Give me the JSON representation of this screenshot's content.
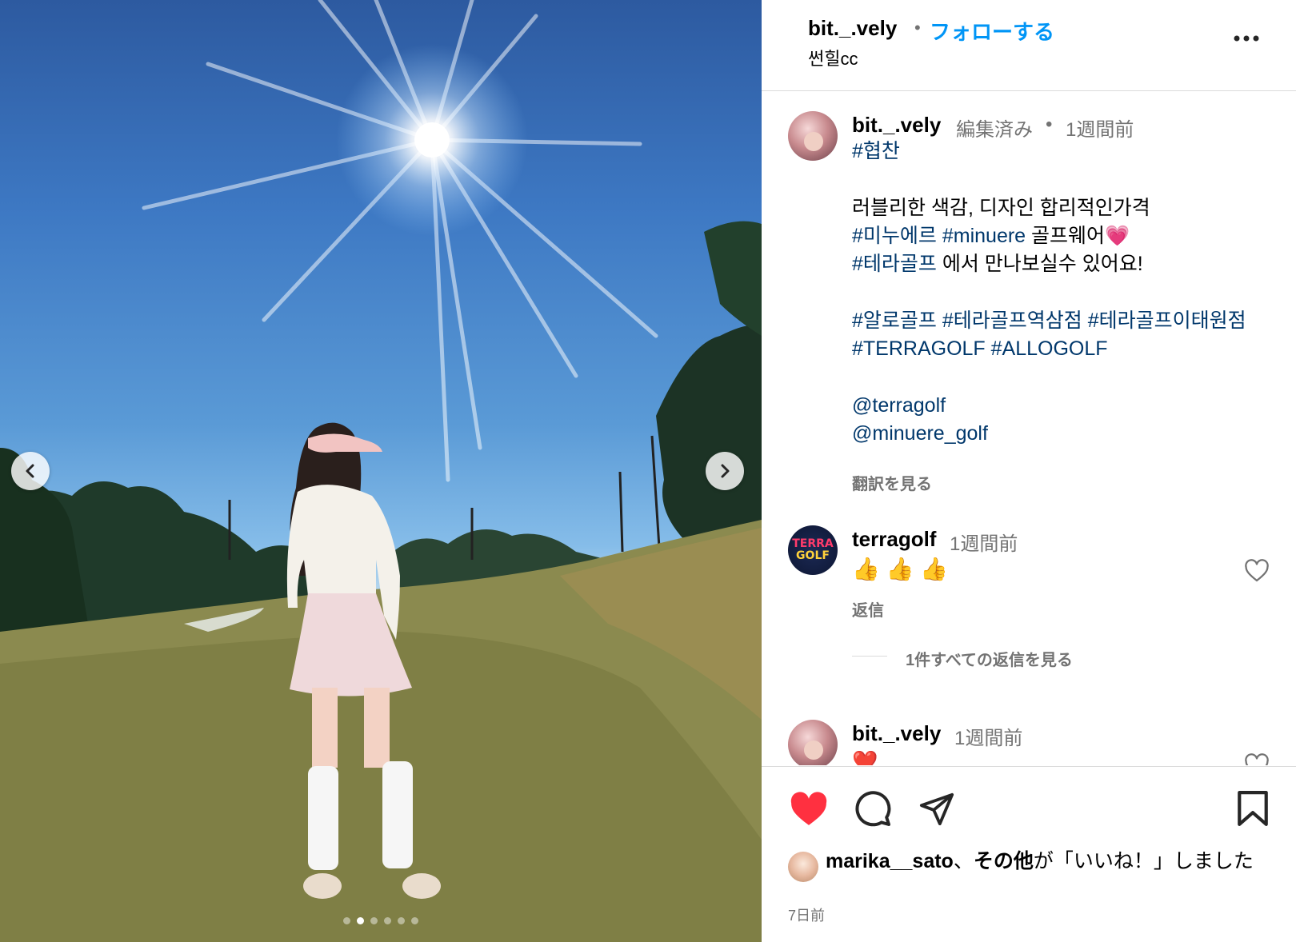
{
  "post": {
    "username": "bit._.vely",
    "follow_label": "フォローする",
    "location": "썬힐cc",
    "slide_count": 6,
    "active_slide": 2
  },
  "caption": {
    "username": "bit._.vely",
    "edited": "編集済み",
    "separator": "•",
    "time": "1週間前",
    "line1": "#협찬",
    "line2": "러블리한 색감, 디자인 합리적인가격",
    "line3_tag1": "#미누에르",
    "line3_tag2": "#minuere",
    "line3_text": "골프웨어💗",
    "line4_tag": "#테라골프",
    "line4_text": "에서 만나보실수 있어요!",
    "line5": "#알로골프 #테라골프역삼점 #테라골프이태원점",
    "line6": "#TERRAGOLF #ALLOGOLF",
    "mention1": "@terragolf",
    "mention2": "@minuere_golf",
    "translate": "翻訳を見る"
  },
  "comments": [
    {
      "username": "terragolf",
      "time": "1週間前",
      "text": "👍 👍 👍",
      "reply": "返信",
      "view_replies": "1件すべての返信を見る",
      "avatar_text_1": "TERRA",
      "avatar_text_2": "GOLF"
    },
    {
      "username": "bit._.vely",
      "time": "1週間前",
      "text": "❤️"
    }
  ],
  "likes": {
    "liked_by": "marika__sato",
    "joiner": "、",
    "others": "その他",
    "suffix": "が「いいね！」しました"
  },
  "date": "7日前",
  "colors": {
    "link": "#0095f6",
    "hashtag": "#00376b",
    "like": "#ff3040",
    "muted": "#737373"
  }
}
